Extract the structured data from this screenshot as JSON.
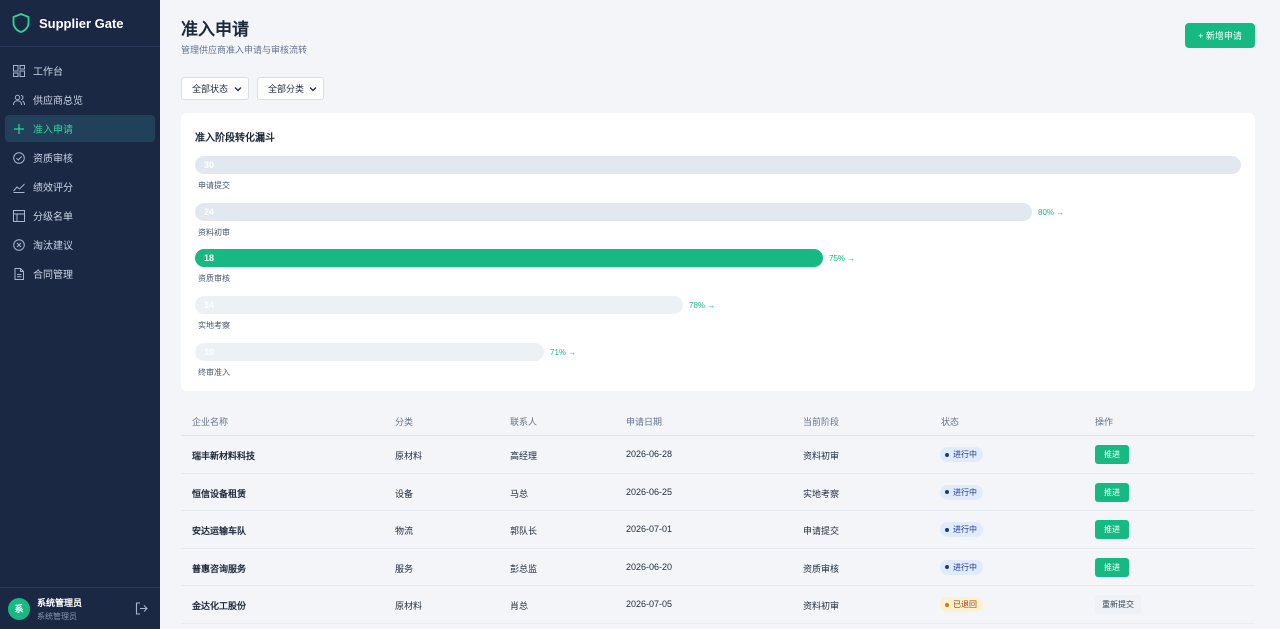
{
  "sidebar": {
    "brand": "Supplier Gate",
    "items": [
      {
        "label": "工作台",
        "icon": "dashboard-icon",
        "active": false
      },
      {
        "label": "供应商总览",
        "icon": "users-icon",
        "active": false
      },
      {
        "label": "准入申请",
        "icon": "plus-icon",
        "active": true
      },
      {
        "label": "资质审核",
        "icon": "check-circle-icon",
        "active": false
      },
      {
        "label": "绩效评分",
        "icon": "trend-chart-icon",
        "active": false
      },
      {
        "label": "分级名单",
        "icon": "table-icon",
        "active": false
      },
      {
        "label": "淘汰建议",
        "icon": "x-circle-icon",
        "active": false
      },
      {
        "label": "合同管理",
        "icon": "document-icon",
        "active": false
      }
    ],
    "user": {
      "avatar": "系",
      "name": "系统管理员",
      "role": "系统管理员"
    }
  },
  "header": {
    "title": "准入申请",
    "subtitle": "管理供应商准入申请与审核流转",
    "add_button": "+ 新增申请"
  },
  "filters": {
    "status": "全部状态",
    "category": "全部分类"
  },
  "funnel": {
    "title": "准入阶段转化漏斗",
    "stages": [
      {
        "label": "申请提交",
        "value": 30,
        "rate": ""
      },
      {
        "label": "资料初审",
        "value": 24,
        "rate": "80% →"
      },
      {
        "label": "资质审核",
        "value": 18,
        "rate": "75% →"
      },
      {
        "label": "实地考察",
        "value": 14,
        "rate": "78% →"
      },
      {
        "label": "终审准入",
        "value": 10,
        "rate": "71% →"
      }
    ]
  },
  "table": {
    "columns": [
      "企业名称",
      "分类",
      "联系人",
      "申请日期",
      "当前阶段",
      "状态",
      "操作"
    ],
    "rows": [
      {
        "name": "瑞丰新材料科技",
        "category": "原材料",
        "contact": "高经理",
        "date": "2026-06-28",
        "stage": "资料初审",
        "status": "进行中",
        "action": "推进"
      },
      {
        "name": "恒信设备租赁",
        "category": "设备",
        "contact": "马总",
        "date": "2026-06-25",
        "stage": "实地考察",
        "status": "进行中",
        "action": "推进"
      },
      {
        "name": "安达运输车队",
        "category": "物流",
        "contact": "郭队长",
        "date": "2026-07-01",
        "stage": "申请提交",
        "status": "进行中",
        "action": "推进"
      },
      {
        "name": "普惠咨询服务",
        "category": "服务",
        "contact": "彭总监",
        "date": "2026-06-20",
        "stage": "资质审核",
        "status": "进行中",
        "action": "推进"
      },
      {
        "name": "金达化工股份",
        "category": "原材料",
        "contact": "肖总",
        "date": "2026-07-05",
        "stage": "资料初审",
        "status": "已退回",
        "action": "重新提交"
      }
    ]
  },
  "colors": {
    "accent": "#16b982",
    "sidebar_bg": "#1b2844",
    "bar_idle": "#e2e8f0",
    "badge_progress": "#e0ecfb",
    "badge_returned": "#fdf1cf"
  }
}
